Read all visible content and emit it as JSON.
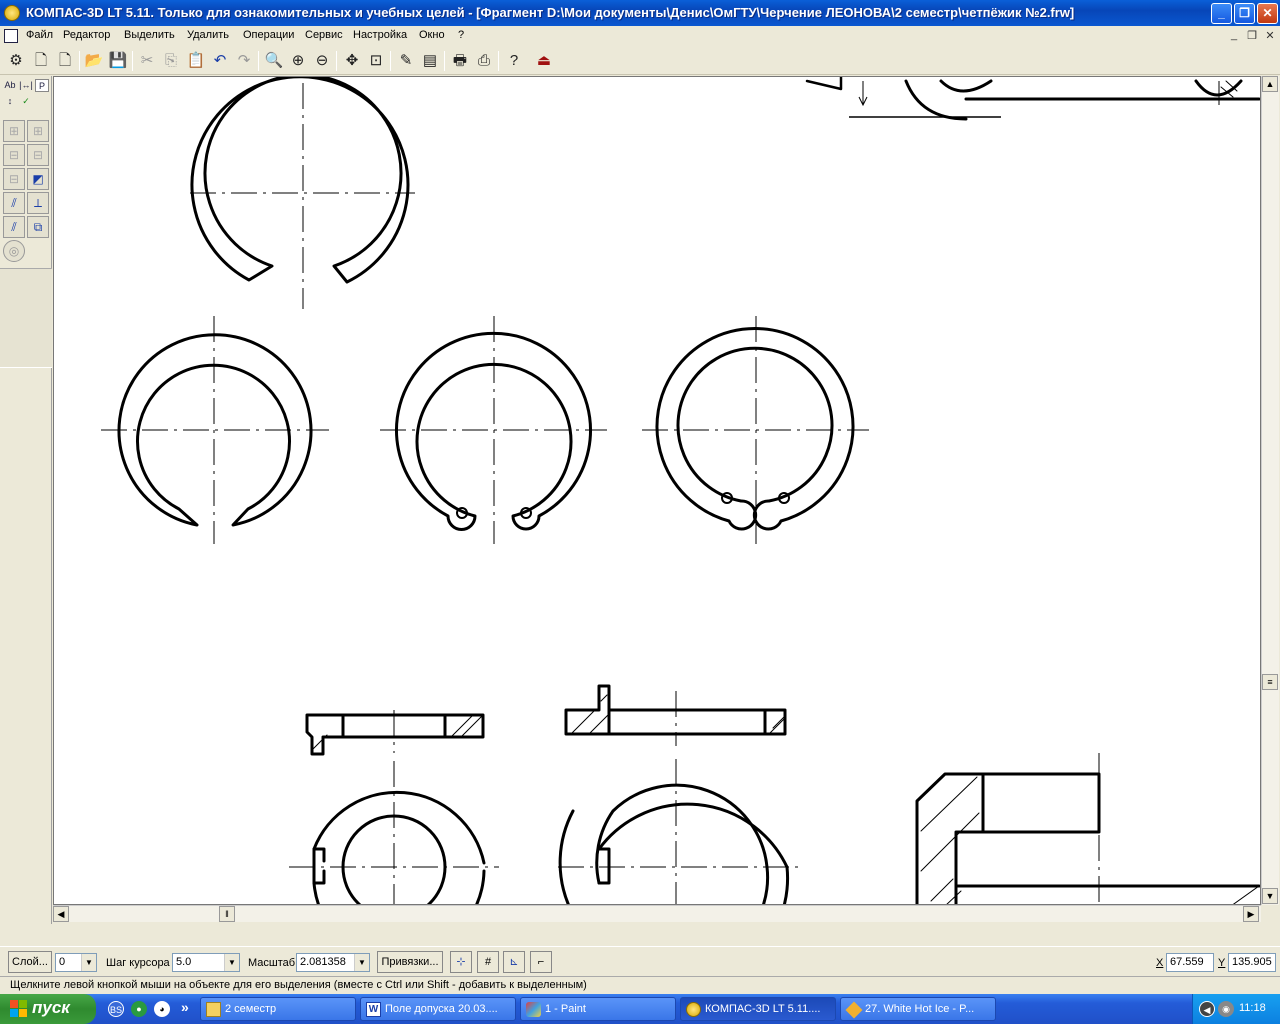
{
  "window": {
    "title": "КОМПАС-3D LT 5.11. Только для ознакомительных и учебных целей - [Фрагмент D:\\Мои документы\\Денис\\ОмГТУ\\Черчение ЛЕОНОВА\\2 семестр\\четпёжик №2.frw]",
    "min_label": "_",
    "max_label": "❐",
    "close_label": "✕"
  },
  "menu": {
    "items": [
      "Файл",
      "Редактор",
      "Выделить",
      "Удалить",
      "Операции",
      "Сервис",
      "Настройка",
      "Окно",
      "?"
    ],
    "doc_min": "_",
    "doc_restore": "❐",
    "doc_close": "✕"
  },
  "left_panel": {
    "tabs": [
      "Ab",
      "|↔|",
      "P"
    ]
  },
  "params": {
    "layer_button": "Слой...",
    "layer_value": "0",
    "step_label": "Шаг курсора",
    "step_value": "5.0",
    "scale_label": "Масштаб",
    "scale_value": "2.081358",
    "snaps_button": "Привязки...",
    "x_label": "X",
    "x_value": "67.559",
    "y_label": "Y",
    "y_value": "135.905"
  },
  "hint_text": "Щелкните левой кнопкой мыши на объекте для его выделения (вместе с Ctrl или Shift - добавить к выделенным)",
  "taskbar": {
    "start_label": "пуск",
    "chevron": "»",
    "tasks": [
      {
        "label": "2 семестр",
        "icon": "folder-icon"
      },
      {
        "label": "Поле допуска 20.03....",
        "icon": "word-icon"
      },
      {
        "label": "1 - Paint",
        "icon": "paint-icon"
      },
      {
        "label": "КОМПАС-3D LT 5.11....",
        "icon": "kompas-icon"
      },
      {
        "label": "27. White Hot Ice - P...",
        "icon": "player-icon"
      }
    ],
    "clock": "11:18"
  },
  "colors": {
    "titlebar": "#0a5fd8",
    "taskbar": "#245cd8",
    "start": "#2f8a2f",
    "drawing_line": "#000000"
  }
}
